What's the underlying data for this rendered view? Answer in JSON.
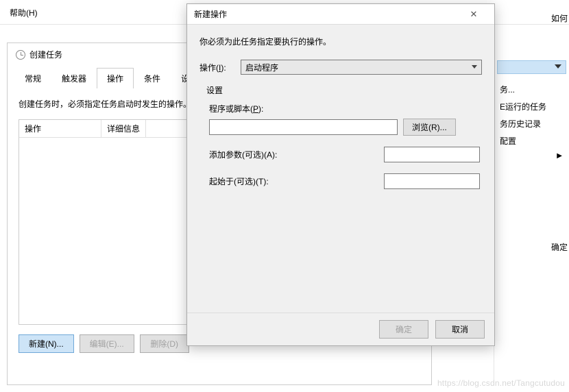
{
  "menu": {
    "help": "帮助(H)"
  },
  "rightText": {
    "ru": "如何",
    "que": "确定"
  },
  "rightPane": {
    "item_cut": "务...",
    "running": "E运行的任务",
    "history": "务历史记录",
    "config": "配置"
  },
  "createTask": {
    "title": "创建任务",
    "tabs": {
      "general": "常规",
      "triggers": "触发器",
      "actions": "操作",
      "conditions": "条件",
      "settings": "设置"
    },
    "desc": "创建任务时，必须指定任务启动时发生的操作。",
    "cols": {
      "action": "操作",
      "detail": "详细信息"
    },
    "buttons": {
      "newbtn": "新建(N)...",
      "editbtn": "编辑(E)...",
      "delbtn": "删除(D)"
    }
  },
  "newAction": {
    "title": "新建操作",
    "desc": "你必须为此任务指定要执行的操作。",
    "actionLabel": "操作(I):",
    "actionOption": "启动程序",
    "settings": "设置",
    "programLabel": "程序或脚本(P):",
    "browse": "浏览(R)...",
    "argsLabel": "添加参数(可选)(A):",
    "startInLabel": "起始于(可选)(T):",
    "ok": "确定",
    "cancel": "取消"
  },
  "watermark": "https://blog.csdn.net/Tangcutudou"
}
